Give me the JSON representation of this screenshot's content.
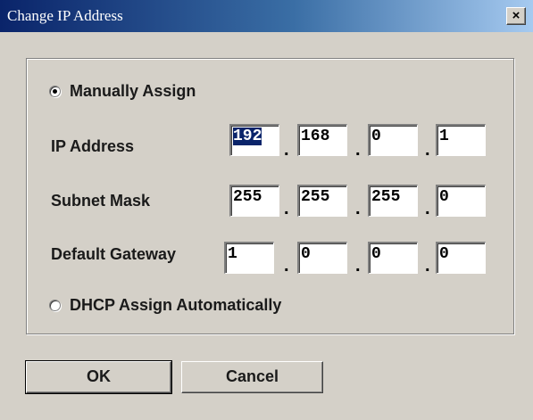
{
  "window": {
    "title": "Change IP Address",
    "close_label": "×"
  },
  "options": {
    "manual_label": "Manually Assign",
    "manual_selected": true,
    "dhcp_label": "DHCP Assign Automatically",
    "dhcp_selected": false
  },
  "fields": [
    {
      "label": "IP Address",
      "octets": [
        "192",
        "168",
        "0",
        "1"
      ],
      "selected_octet": 0
    },
    {
      "label": "Subnet Mask",
      "octets": [
        "255",
        "255",
        "255",
        "0"
      ]
    },
    {
      "label": "Default Gateway",
      "octets": [
        "1",
        "0",
        "0",
        "0"
      ]
    }
  ],
  "separator": ".",
  "buttons": {
    "ok": "OK",
    "cancel": "Cancel"
  },
  "colors": {
    "title_start": "#0a246a",
    "title_end": "#a6caf0",
    "face": "#d4d0c8",
    "selection": "#0a246a"
  }
}
